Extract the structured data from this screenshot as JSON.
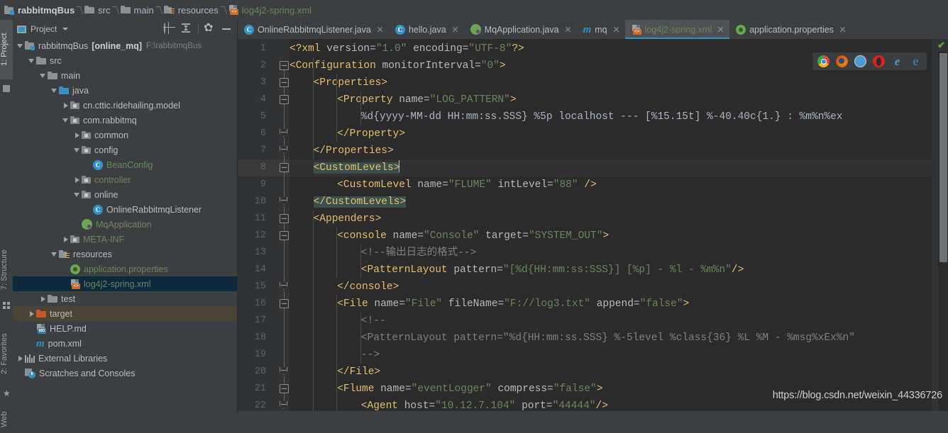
{
  "breadcrumb": [
    {
      "label": "rabbitmqBus",
      "icon": "module-icon",
      "style": "bold"
    },
    {
      "label": "src",
      "icon": "folder-icon",
      "style": "normal"
    },
    {
      "label": "main",
      "icon": "folder-icon",
      "style": "normal"
    },
    {
      "label": "resources",
      "icon": "resources-folder-icon",
      "style": "normal"
    },
    {
      "label": "log4j2-spring.xml",
      "icon": "xml-file-icon",
      "style": "xmlfile"
    }
  ],
  "tool_window_tabs": {
    "project": "1: Project",
    "structure": "7: Structure",
    "favorites": "2: Favorites",
    "web": "Web"
  },
  "project_panel": {
    "title": "Project",
    "toolbar_icons": [
      "locate-target-icon",
      "collapse-all-icon",
      "gear-icon",
      "hide-icon"
    ],
    "tree": [
      {
        "depth": 0,
        "arrow": "down",
        "icon": "module-icon",
        "label": "rabbitmqBus",
        "bold_suffix": "[online_mq]",
        "path": "F:\\rabbitmqBus",
        "color": "default",
        "state": "normal"
      },
      {
        "depth": 1,
        "arrow": "down",
        "icon": "folder-icon",
        "label": "src",
        "color": "default",
        "state": "normal"
      },
      {
        "depth": 2,
        "arrow": "down",
        "icon": "folder-icon",
        "label": "main",
        "color": "default",
        "state": "normal"
      },
      {
        "depth": 3,
        "arrow": "down",
        "icon": "folder-blue-icon",
        "label": "java",
        "color": "default",
        "state": "normal"
      },
      {
        "depth": 4,
        "arrow": "right",
        "icon": "package-icon",
        "label": "cn.cttic.ridehailing.model",
        "color": "default",
        "state": "normal"
      },
      {
        "depth": 4,
        "arrow": "down",
        "icon": "package-icon",
        "label": "com.rabbitmq",
        "color": "default",
        "state": "normal"
      },
      {
        "depth": 5,
        "arrow": "right",
        "icon": "package-icon",
        "label": "common",
        "color": "default",
        "state": "normal"
      },
      {
        "depth": 5,
        "arrow": "down",
        "icon": "package-icon",
        "label": "config",
        "color": "default",
        "state": "normal"
      },
      {
        "depth": 6,
        "arrow": "none",
        "icon": "java-class-icon",
        "label": "BeanConfig",
        "color": "green",
        "state": "normal"
      },
      {
        "depth": 5,
        "arrow": "right",
        "icon": "package-icon",
        "label": "controller",
        "color": "green",
        "state": "normal"
      },
      {
        "depth": 5,
        "arrow": "down",
        "icon": "package-icon",
        "label": "online",
        "color": "default",
        "state": "normal"
      },
      {
        "depth": 6,
        "arrow": "none",
        "icon": "java-class-icon",
        "label": "OnlineRabbitmqListener",
        "color": "default",
        "state": "normal"
      },
      {
        "depth": 5,
        "arrow": "none",
        "icon": "spring-boot-icon",
        "label": "MqApplication",
        "color": "green",
        "state": "normal"
      },
      {
        "depth": 4,
        "arrow": "right",
        "icon": "package-icon",
        "label": "META-INF",
        "color": "green",
        "state": "normal"
      },
      {
        "depth": 3,
        "arrow": "down",
        "icon": "resources-folder-icon",
        "label": "resources",
        "color": "default",
        "state": "normal"
      },
      {
        "depth": 4,
        "arrow": "none",
        "icon": "spring-icon",
        "label": "application.properties",
        "color": "green",
        "state": "normal"
      },
      {
        "depth": 4,
        "arrow": "none",
        "icon": "xml-file-icon",
        "label": "log4j2-spring.xml",
        "color": "green",
        "state": "selected"
      },
      {
        "depth": 2,
        "arrow": "right",
        "icon": "folder-icon",
        "label": "test",
        "color": "default",
        "state": "normal"
      },
      {
        "depth": 1,
        "arrow": "right",
        "icon": "folder-orange-icon",
        "label": "target",
        "color": "default",
        "state": "excluded"
      },
      {
        "depth": 1,
        "arrow": "none",
        "icon": "markdown-file-icon",
        "label": "HELP.md",
        "color": "default",
        "state": "normal"
      },
      {
        "depth": 1,
        "arrow": "none",
        "icon": "maven-icon",
        "label": "pom.xml",
        "color": "default",
        "state": "normal"
      },
      {
        "depth": 0,
        "arrow": "right",
        "icon": "library-icon",
        "label": "External Libraries",
        "color": "default",
        "state": "normal"
      },
      {
        "depth": 0,
        "arrow": "none",
        "icon": "scratches-icon",
        "label": "Scratches and Consoles",
        "color": "default",
        "state": "normal"
      }
    ]
  },
  "editor_tabs": [
    {
      "label": "OnlineRabbitmqListener.java",
      "icon": "java-class-icon",
      "active": false
    },
    {
      "label": "hello.java",
      "icon": "java-class-icon",
      "active": false
    },
    {
      "label": "MqApplication.java",
      "icon": "spring-boot-icon",
      "active": false
    },
    {
      "label": "mq",
      "icon": "maven-icon",
      "active": false
    },
    {
      "label": "log4j2-spring.xml",
      "icon": "xml-file-icon",
      "active": true
    },
    {
      "label": "application.properties",
      "icon": "spring-icon",
      "active": false
    }
  ],
  "code": {
    "language": "xml",
    "first_line_number": 1,
    "lines": [
      {
        "n": 1,
        "indent": 0,
        "tokens": [
          {
            "t": "<?xml ",
            "c": "tag"
          },
          {
            "t": "version",
            "c": "attr"
          },
          {
            "t": "=",
            "c": "punct"
          },
          {
            "t": "\"1.0\"",
            "c": "val"
          },
          {
            "t": " ",
            "c": "txt"
          },
          {
            "t": "encoding",
            "c": "attr"
          },
          {
            "t": "=",
            "c": "punct"
          },
          {
            "t": "\"UTF-8\"",
            "c": "val"
          },
          {
            "t": "?>",
            "c": "tag"
          }
        ]
      },
      {
        "n": 2,
        "indent": 0,
        "tokens": [
          {
            "t": "<Configuration ",
            "c": "tag"
          },
          {
            "t": "monitorInterval",
            "c": "attr"
          },
          {
            "t": "=",
            "c": "punct"
          },
          {
            "t": "\"0\"",
            "c": "val"
          },
          {
            "t": ">",
            "c": "tag"
          }
        ]
      },
      {
        "n": 3,
        "indent": 1,
        "tokens": [
          {
            "t": "<Properties>",
            "c": "tag"
          }
        ]
      },
      {
        "n": 4,
        "indent": 2,
        "tokens": [
          {
            "t": "<Property ",
            "c": "tag"
          },
          {
            "t": "name",
            "c": "attr"
          },
          {
            "t": "=",
            "c": "punct"
          },
          {
            "t": "\"LOG_PATTERN\"",
            "c": "val"
          },
          {
            "t": ">",
            "c": "tag"
          }
        ]
      },
      {
        "n": 5,
        "indent": 3,
        "tokens": [
          {
            "t": "%d{yyyy-MM-dd HH:mm:ss.SSS} %5p localhost --- [%15.15t] %-40.40c{1.} : %m%n%ex",
            "c": "txt"
          }
        ]
      },
      {
        "n": 6,
        "indent": 2,
        "tokens": [
          {
            "t": "</Property>",
            "c": "tag"
          }
        ]
      },
      {
        "n": 7,
        "indent": 1,
        "tokens": [
          {
            "t": "</Properties>",
            "c": "tag"
          }
        ]
      },
      {
        "n": 8,
        "indent": 1,
        "current": true,
        "tokens": [
          {
            "t": "<CustomLevels>",
            "c": "tag",
            "match": true
          },
          {
            "t": "|CARET|",
            "c": "caret"
          }
        ]
      },
      {
        "n": 9,
        "indent": 2,
        "tokens": [
          {
            "t": "<CustomLevel ",
            "c": "tag"
          },
          {
            "t": "name",
            "c": "attr"
          },
          {
            "t": "=",
            "c": "punct"
          },
          {
            "t": "\"FLUME\"",
            "c": "val"
          },
          {
            "t": " ",
            "c": "txt"
          },
          {
            "t": "intLevel",
            "c": "attr"
          },
          {
            "t": "=",
            "c": "punct"
          },
          {
            "t": "\"88\"",
            "c": "val"
          },
          {
            "t": " />",
            "c": "tag"
          }
        ]
      },
      {
        "n": 10,
        "indent": 1,
        "tokens": [
          {
            "t": "</CustomLevels>",
            "c": "tag",
            "match": true
          }
        ]
      },
      {
        "n": 11,
        "indent": 1,
        "tokens": [
          {
            "t": "<Appenders>",
            "c": "tag"
          }
        ]
      },
      {
        "n": 12,
        "indent": 2,
        "tokens": [
          {
            "t": "<console ",
            "c": "tag"
          },
          {
            "t": "name",
            "c": "attr"
          },
          {
            "t": "=",
            "c": "punct"
          },
          {
            "t": "\"Console\"",
            "c": "val"
          },
          {
            "t": " ",
            "c": "txt"
          },
          {
            "t": "target",
            "c": "attr"
          },
          {
            "t": "=",
            "c": "punct"
          },
          {
            "t": "\"SYSTEM_OUT\"",
            "c": "val"
          },
          {
            "t": ">",
            "c": "tag"
          }
        ]
      },
      {
        "n": 13,
        "indent": 3,
        "tokens": [
          {
            "t": "<!--输出日志的格式-->",
            "c": "cmt"
          }
        ]
      },
      {
        "n": 14,
        "indent": 3,
        "tokens": [
          {
            "t": "<PatternLayout ",
            "c": "tag"
          },
          {
            "t": "pattern",
            "c": "attr"
          },
          {
            "t": "=",
            "c": "punct"
          },
          {
            "t": "\"[%d{HH:mm:ss:SSS}] [%p] - %l - %m%n\"",
            "c": "val"
          },
          {
            "t": "/>",
            "c": "tag"
          }
        ]
      },
      {
        "n": 15,
        "indent": 2,
        "tokens": [
          {
            "t": "</console>",
            "c": "tag"
          }
        ]
      },
      {
        "n": 16,
        "indent": 2,
        "tokens": [
          {
            "t": "<File ",
            "c": "tag"
          },
          {
            "t": "name",
            "c": "attr"
          },
          {
            "t": "=",
            "c": "punct"
          },
          {
            "t": "\"File\"",
            "c": "val"
          },
          {
            "t": " ",
            "c": "txt"
          },
          {
            "t": "fileName",
            "c": "attr"
          },
          {
            "t": "=",
            "c": "punct"
          },
          {
            "t": "\"F://log3.txt\"",
            "c": "val"
          },
          {
            "t": " ",
            "c": "txt"
          },
          {
            "t": "append",
            "c": "attr"
          },
          {
            "t": "=",
            "c": "punct"
          },
          {
            "t": "\"false\"",
            "c": "val"
          },
          {
            "t": ">",
            "c": "tag"
          }
        ]
      },
      {
        "n": 17,
        "indent": 3,
        "tokens": [
          {
            "t": "<!--",
            "c": "cmt"
          }
        ]
      },
      {
        "n": 18,
        "indent": 3,
        "tokens": [
          {
            "t": "<PatternLayout pattern=\"%d{HH:mm:ss.SSS} %-5level %class{36} %L %M - %msg%xEx%n\"",
            "c": "cmt"
          }
        ]
      },
      {
        "n": 19,
        "indent": 3,
        "tokens": [
          {
            "t": "-->",
            "c": "cmt"
          }
        ]
      },
      {
        "n": 20,
        "indent": 2,
        "tokens": [
          {
            "t": "</File>",
            "c": "tag"
          }
        ]
      },
      {
        "n": 21,
        "indent": 2,
        "tokens": [
          {
            "t": "<Flume ",
            "c": "tag"
          },
          {
            "t": "name",
            "c": "attr"
          },
          {
            "t": "=",
            "c": "punct"
          },
          {
            "t": "\"eventLogger\"",
            "c": "val"
          },
          {
            "t": " ",
            "c": "txt"
          },
          {
            "t": "compress",
            "c": "attr"
          },
          {
            "t": "=",
            "c": "punct"
          },
          {
            "t": "\"false\"",
            "c": "val"
          },
          {
            "t": ">",
            "c": "tag"
          }
        ]
      },
      {
        "n": 22,
        "indent": 3,
        "tokens": [
          {
            "t": "<Agent ",
            "c": "tag"
          },
          {
            "t": "host",
            "c": "attr"
          },
          {
            "t": "=",
            "c": "punct"
          },
          {
            "t": "\"10.12.7.104\"",
            "c": "val"
          },
          {
            "t": " ",
            "c": "txt"
          },
          {
            "t": "port",
            "c": "attr"
          },
          {
            "t": "=",
            "c": "punct"
          },
          {
            "t": "\"44444\"",
            "c": "val"
          },
          {
            "t": "/>",
            "c": "tag"
          }
        ]
      }
    ]
  },
  "browser_bar": {
    "icons": [
      "chrome-icon",
      "firefox-icon",
      "safari-icon",
      "opera-icon",
      "internet-explorer-icon",
      "edge-icon"
    ]
  },
  "inspection": {
    "status_icon": "green-check-icon"
  },
  "watermark": "https://blog.csdn.net/weixin_44336726",
  "colors": {
    "panel_bg": "#3c3f41",
    "editor_bg": "#2b2b2b",
    "gutter_bg": "#313335",
    "accent_blue": "#3592c4",
    "selection_blue": "#0d293e",
    "excluded_brown": "#4b4335",
    "tag_orange": "#e8bf6a",
    "string_green": "#6a8759",
    "comment_gray": "#808080",
    "text_gray": "#a9b7c6",
    "match_teal": "#3b514d"
  }
}
